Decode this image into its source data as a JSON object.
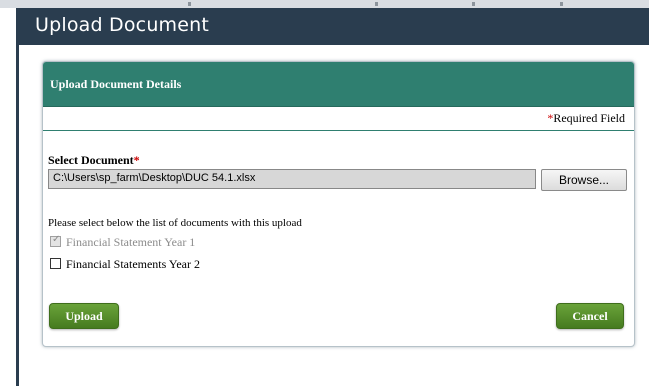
{
  "dialog": {
    "title": "Upload Document",
    "panel_title": "Upload Document Details",
    "required_star": "*",
    "required_label": "Required Field"
  },
  "form": {
    "select_label": "Select Document",
    "select_star": "*",
    "file_path": "C:\\Users\\sp_farm\\Desktop\\DUC 54.1.xlsx",
    "browse_label": "Browse...",
    "instructions": "Please select below the list of documents with this upload",
    "checkboxes": [
      {
        "label": "Financial Statement Year 1",
        "checked": true,
        "disabled": true
      },
      {
        "label": "Financial Statements Year 2",
        "checked": false,
        "disabled": false
      }
    ]
  },
  "actions": {
    "upload_label": "Upload",
    "cancel_label": "Cancel"
  },
  "colors": {
    "title_bar": "#2a3d4f",
    "panel_header": "#2f7f70",
    "button_green": "#467b1f",
    "required_star": "#cc0000"
  }
}
